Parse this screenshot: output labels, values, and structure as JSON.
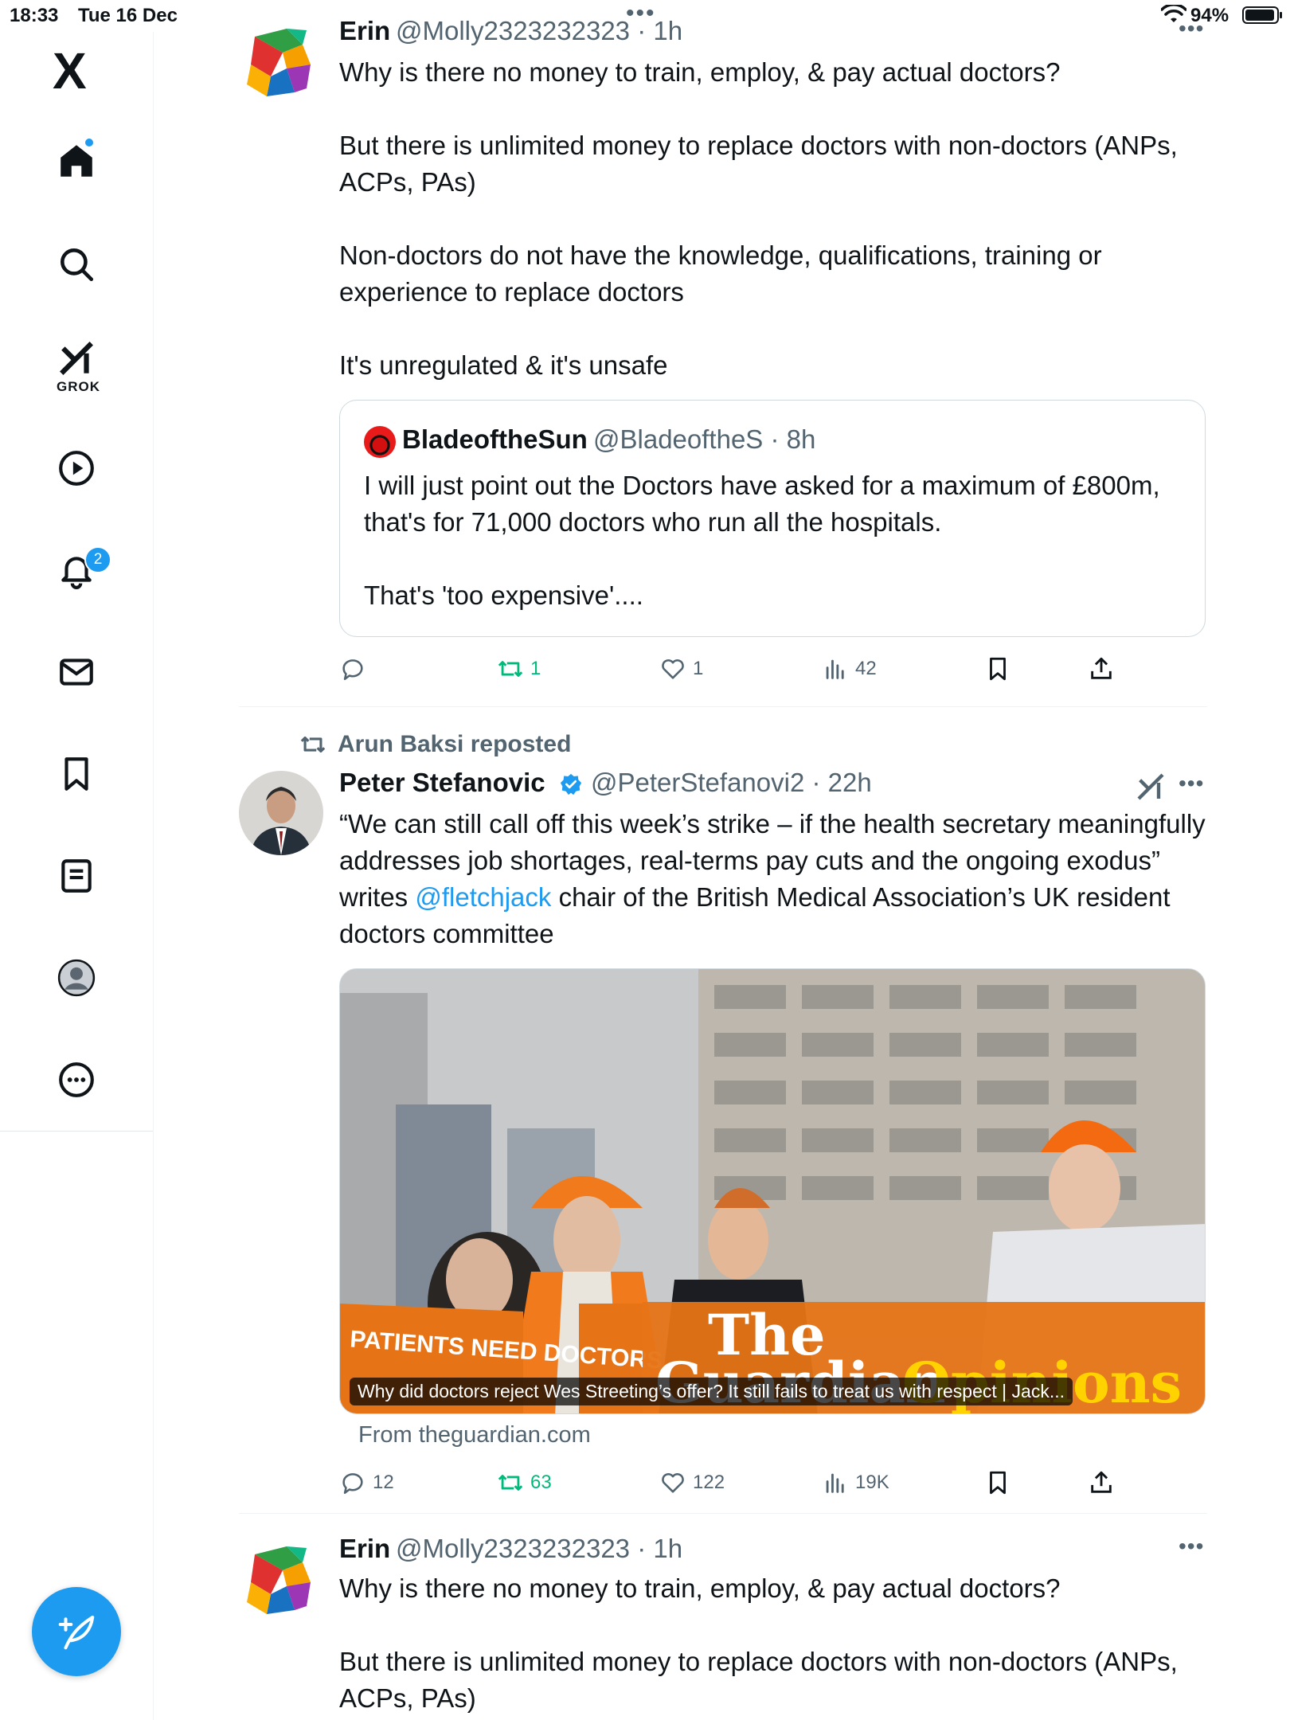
{
  "status_bar": {
    "time": "18:33",
    "date": "Tue 16 Dec",
    "battery": "94%"
  },
  "sidebar": {
    "logo": "X",
    "grok_label": "GROK",
    "notifications_badge": "2"
  },
  "tweet1": {
    "name": "Erin",
    "handle": "@Molly2323232323 · 1h",
    "text": "Why is there no money to train, employ, & pay actual doctors?\n\nBut there is unlimited money to replace doctors with non-doctors (ANPs, ACPs, PAs)\n\nNon-doctors do not have the knowledge, qualifications, training or experience to replace doctors\n\nIt's unregulated & it's unsafe",
    "quote": {
      "name": "BladeoftheSun",
      "handle": "@BladeoftheS · 8h",
      "text": "I will just point out the Doctors have asked for a maximum of £800m, that's for 71,000 doctors who run all the hospitals.\n\nThat's 'too expensive'...."
    },
    "actions": {
      "replies": "",
      "reposts": "1",
      "likes": "1",
      "views": "42"
    }
  },
  "tweet2": {
    "repost_by": "Arun Baksi reposted",
    "name": "Peter Stefanovic",
    "handle": "@PeterStefanovi2 · 22h",
    "text_before": "“We can still call off this week’s strike – if the health secretary meaningfully addresses job shortages, real-terms pay cuts and the ongoing exodus” writes ",
    "mention": "@fletchjack",
    "text_after": " chair of the British Medical Association’s UK resident doctors committee",
    "media_caption": "Why did doctors reject Wes Streeting’s offer? It still fails to treat us with respect | Jack...",
    "media_source": "From theguardian.com",
    "media_sign": "PATIENTS NEED DOCTORS",
    "media_brand": {
      "the": "The",
      "guardian": "Guardian",
      "opinions": "Opinions"
    },
    "actions": {
      "replies": "12",
      "reposts": "63",
      "likes": "122",
      "views": "19K"
    }
  },
  "tweet3": {
    "name": "Erin",
    "handle": "@Molly2323232323 · 1h",
    "text": "Why is there no money to train, employ, & pay actual doctors?\n\nBut there is unlimited money to replace doctors with non-doctors (ANPs, ACPs, PAs)"
  },
  "colors": {
    "accent": "#1d9bf0",
    "repost_green": "#00ba7c",
    "muted": "#536471"
  }
}
